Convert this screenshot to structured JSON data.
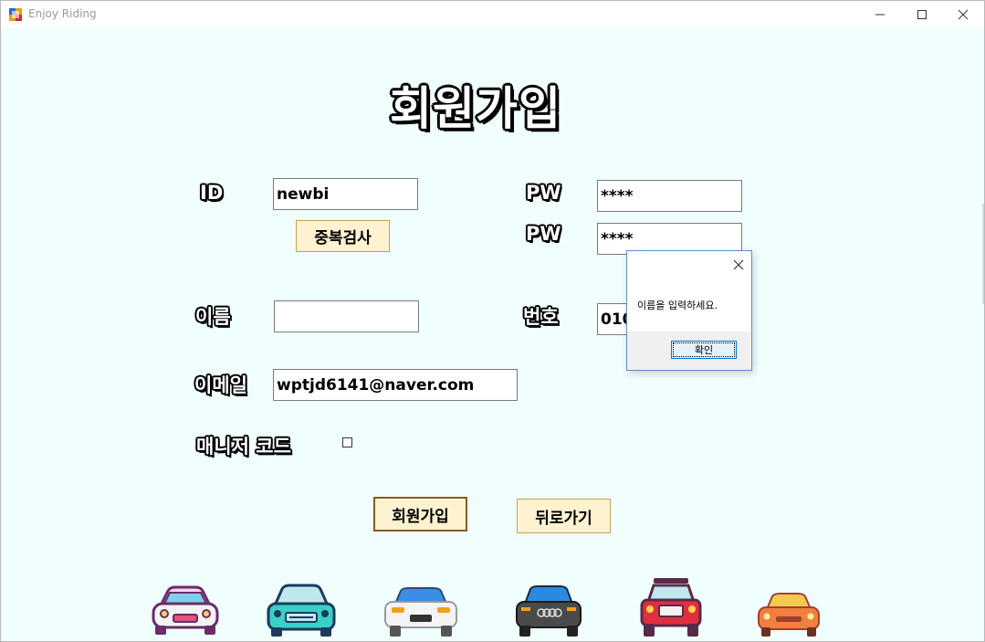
{
  "window": {
    "title": "Enjoy Riding"
  },
  "form": {
    "heading": "회원가입",
    "id_label": "ID",
    "id_value": "newbi",
    "dup_check_button": "중복검사",
    "pw_label": "PW",
    "pw_value": "****",
    "pw_confirm_label": "PW",
    "pw_confirm_value": "****",
    "name_label": "이름",
    "name_value": "",
    "phone_label": "번호",
    "phone_value": "010",
    "email_label": "이메일",
    "email_value": "wptjd6141@naver.com",
    "manager_code_label": "매니저 코드",
    "manager_code_checked": false,
    "signup_button": "회원가입",
    "back_button": "뒤로가기"
  },
  "dialog": {
    "message": "이름을 입력하세요.",
    "ok_button": "확인"
  },
  "cars": [
    "car-icon",
    "car-icon",
    "car-icon",
    "car-icon",
    "car-icon",
    "car-icon"
  ],
  "colors": {
    "background": "#f0fffe",
    "button_bg": "#fff2d0",
    "dialog_border": "#5a8fd0"
  }
}
